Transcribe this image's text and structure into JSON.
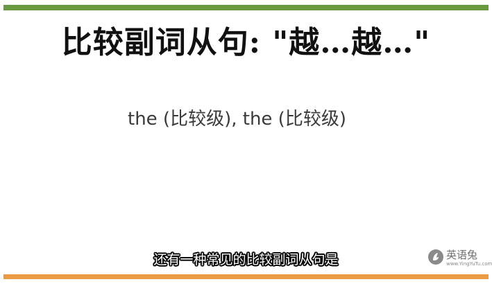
{
  "slide": {
    "title": "比较副词从句: \"越…越…\"",
    "formula": "the (比较级), the (比较级)"
  },
  "subtitle": "还有一种常见的比较副词从句是",
  "brand": {
    "name": "英语兔",
    "url": "www.YingYuTu.com",
    "logo_icon": "rabbit-logo-icon"
  },
  "colors": {
    "top_bar": "#6a9a3f",
    "bottom_bar": "#eb9a43",
    "title_text": "#111111",
    "formula_text": "#3a3a3a"
  }
}
